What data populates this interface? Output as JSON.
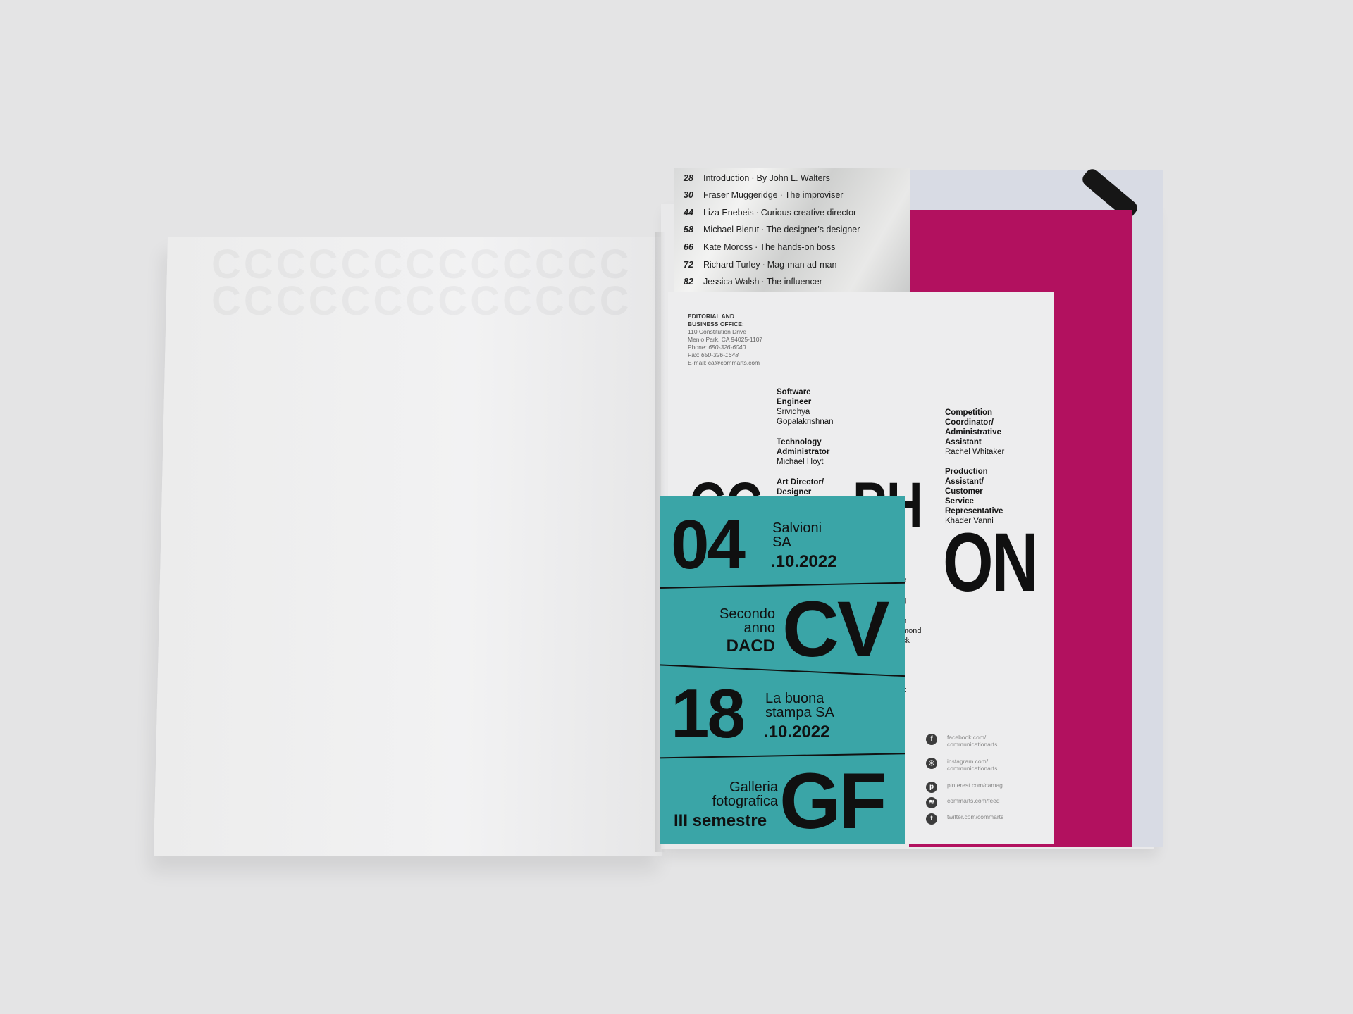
{
  "colors": {
    "background": "#e4e4e5",
    "teal": "#3aa5a7",
    "magenta": "#b2115f",
    "silver": "#e2e3e3"
  },
  "ghost_letters": [
    "CCCCCCCCCCCCC",
    "CCCCCCCCCCCCC"
  ],
  "toc": [
    {
      "page": "28",
      "name": "Introduction",
      "role": "By John L. Walters"
    },
    {
      "page": "30",
      "name": "Fraser Muggeridge",
      "role": "The improviser"
    },
    {
      "page": "44",
      "name": "Liza Enebeis",
      "role": "Curious creative director"
    },
    {
      "page": "58",
      "name": "Michael Bierut",
      "role": "The designer's designer"
    },
    {
      "page": "66",
      "name": "Kate Moross",
      "role": "The hands-on boss"
    },
    {
      "page": "72",
      "name": "Richard Turley",
      "role": "Mag-man ad-man"
    },
    {
      "page": "82",
      "name": "Jessica Walsh",
      "role": "The influencer"
    }
  ],
  "toc_separator": "·",
  "masthead": {
    "office_heading": "EDITORIAL AND\nBUSINESS OFFICE:",
    "address1": "110 Constitution Drive",
    "address2": "Menlo Park, CA 94025-1107",
    "phone_label": "Phone:",
    "phone": "650-326-6040",
    "fax_label": "Fax:",
    "fax": "650-326-1648",
    "email": "E-mail: ca@commarts.com",
    "roles": [
      {
        "title": "Software\nEngineer",
        "name": "Srividhya\nGopalakrishnan"
      },
      {
        "title": "Technology\nAdministrator",
        "name": "Michael Hoyt"
      },
      {
        "title": "Art Director/\nDesigner",
        "name": ""
      },
      {
        "title": "Competition\nCoordinator/\nAdministrative\nAssistant",
        "name": "Rachel Whitaker"
      },
      {
        "title": "Production\nAssistant/\nCustomer\nService\nRepresentative",
        "name": "Khader Vanni"
      }
    ],
    "big_on": "ON",
    "big_ph": "PH",
    "big_cc": "CC",
    "fragments": [
      "e",
      "g",
      "n",
      "mond",
      "ck",
      "k",
      "/"
    ],
    "social": [
      {
        "icon": "facebook-icon",
        "glyph": "f",
        "text": "facebook.com/\ncommunicationarts"
      },
      {
        "icon": "instagram-icon",
        "glyph": "◎",
        "text": "instagram.com/\ncommunicationarts"
      },
      {
        "icon": "pinterest-icon",
        "glyph": "p",
        "text": "pinterest.com/camag"
      },
      {
        "icon": "rss-icon",
        "glyph": "≋",
        "text": "commarts.com/feed"
      },
      {
        "icon": "twitter-icon",
        "glyph": "t",
        "text": "twitter.com/commarts"
      }
    ]
  },
  "teal_card": {
    "row1": {
      "big": "04",
      "line1": "Salvioni",
      "line2": "SA",
      "date": ".10.2022"
    },
    "row2": {
      "big": "CV",
      "line1": "Secondo",
      "line2": "anno",
      "line3": "DACD"
    },
    "row3": {
      "big": "18",
      "line1": "La buona",
      "line2": "stampa SA",
      "date": ".10.2022"
    },
    "row4": {
      "big": "GF",
      "line1": "Galleria",
      "line2": "fotografica",
      "line3": "III semestre"
    }
  }
}
